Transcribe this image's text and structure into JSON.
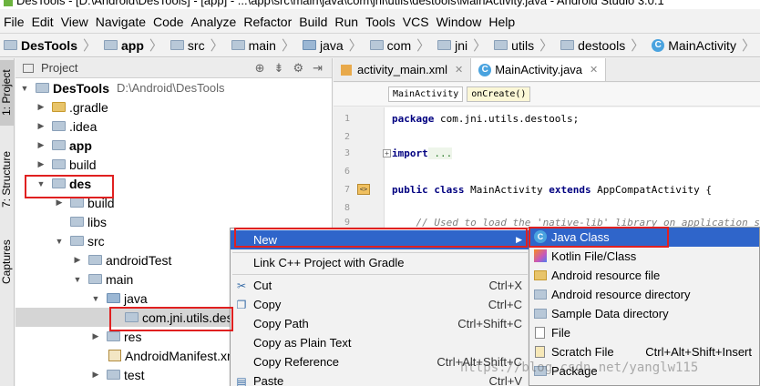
{
  "window": {
    "title": "DesTools - [D:\\Android\\DesTools] - [app] - ...\\app\\src\\main\\java\\com\\jni\\utils\\destools\\MainActivity.java - Android Studio 3.0.1"
  },
  "menubar": [
    "File",
    "Edit",
    "View",
    "Navigate",
    "Code",
    "Analyze",
    "Refactor",
    "Build",
    "Run",
    "Tools",
    "VCS",
    "Window",
    "Help"
  ],
  "breadcrumb": [
    "DesTools",
    "app",
    "src",
    "main",
    "java",
    "com",
    "jni",
    "utils",
    "destools",
    "MainActivity"
  ],
  "left_strip": {
    "project_tab": "1: Project",
    "structure_tab": "7: Structure",
    "captures_tab": "Captures"
  },
  "project_panel": {
    "header": "Project",
    "tree": [
      {
        "label": "DesTools",
        "path": "D:\\Android\\DesTools"
      },
      {
        "label": ".gradle"
      },
      {
        "label": ".idea"
      },
      {
        "label": "app"
      },
      {
        "label": "build"
      },
      {
        "label": "des"
      },
      {
        "label": "build"
      },
      {
        "label": "libs"
      },
      {
        "label": "src"
      },
      {
        "label": "androidTest"
      },
      {
        "label": "main"
      },
      {
        "label": "java"
      },
      {
        "label": "com.jni.utils.des"
      },
      {
        "label": "res"
      },
      {
        "label": "AndroidManifest.xml"
      },
      {
        "label": "test"
      }
    ]
  },
  "editor": {
    "tabs": [
      "activity_main.xml",
      "MainActivity.java"
    ],
    "crumbs": [
      "MainActivity",
      "onCreate()"
    ],
    "lines": [
      {
        "num": "1",
        "code_kw": "package",
        "code_rest": " com.jni.utils.destools;"
      },
      {
        "num": "2",
        "code_kw": "",
        "code_rest": ""
      },
      {
        "num": "3",
        "code_kw": "import",
        "code_rest": " ..."
      },
      {
        "num": "6",
        "code_kw": "",
        "code_rest": ""
      },
      {
        "num": "7",
        "code_kw": "public class",
        "code_rest": " MainActivity ",
        "code_kw2": "extends",
        "code_rest2": " AppCompatActivity {"
      },
      {
        "num": "8",
        "code_kw": "",
        "code_rest": ""
      },
      {
        "num": "9",
        "comment": "    // Used to load the 'native-lib' library on application startup."
      }
    ]
  },
  "context_menu": {
    "items": [
      {
        "label": "New",
        "shortcut": ""
      },
      {
        "label": "Link C++ Project with Gradle",
        "shortcut": ""
      },
      {
        "label": "Cut",
        "shortcut": "Ctrl+X"
      },
      {
        "label": "Copy",
        "shortcut": "Ctrl+C"
      },
      {
        "label": "Copy Path",
        "shortcut": "Ctrl+Shift+C"
      },
      {
        "label": "Copy as Plain Text",
        "shortcut": ""
      },
      {
        "label": "Copy Reference",
        "shortcut": "Ctrl+Alt+Shift+C"
      },
      {
        "label": "Paste",
        "shortcut": "Ctrl+V"
      }
    ]
  },
  "new_submenu": {
    "items": [
      {
        "label": "Java Class",
        "shortcut": ""
      },
      {
        "label": "Kotlin File/Class",
        "shortcut": ""
      },
      {
        "label": "Android resource file",
        "shortcut": ""
      },
      {
        "label": "Android resource directory",
        "shortcut": ""
      },
      {
        "label": "Sample Data directory",
        "shortcut": ""
      },
      {
        "label": "File",
        "shortcut": ""
      },
      {
        "label": "Scratch File",
        "shortcut": "Ctrl+Alt+Shift+Insert"
      },
      {
        "label": "Package",
        "shortcut": ""
      }
    ]
  },
  "watermark": "https://blog.csdn.net/yanglw115",
  "colors": {
    "menu_highlight": "#2f65ca",
    "annotation_red": "#e02020"
  }
}
